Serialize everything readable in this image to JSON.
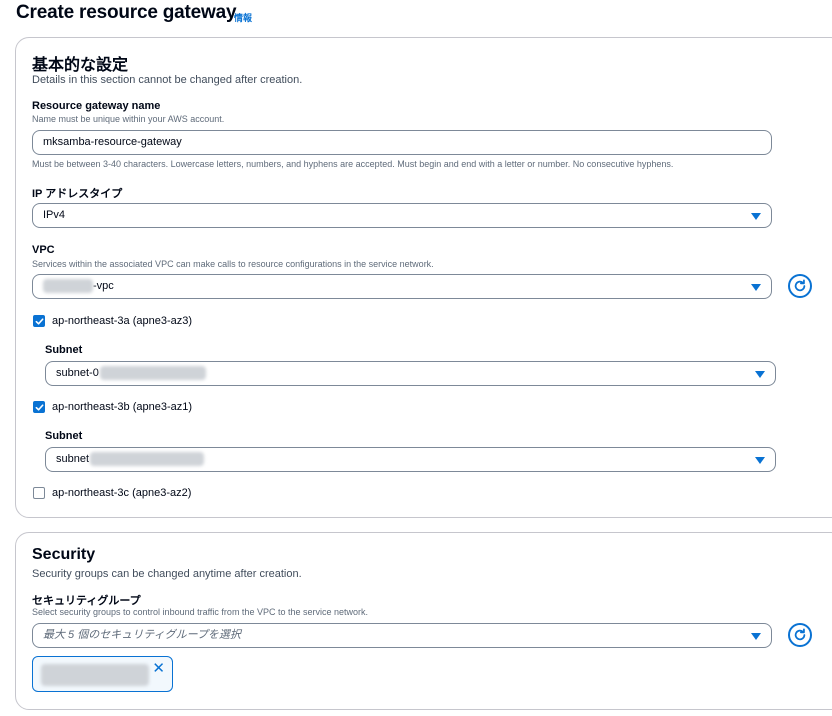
{
  "header": {
    "title": "Create resource gateway",
    "info": "情報"
  },
  "basic": {
    "title": "基本的な設定",
    "description": "Details in this section cannot be changed after creation.",
    "name": {
      "label": "Resource gateway name",
      "sublabel": "Name must be unique within your AWS account.",
      "value": "mksamba-resource-gateway",
      "hint": "Must be between 3-40 characters. Lowercase letters, numbers, and hyphens are accepted. Must begin and end with a letter or number. No consecutive hyphens."
    },
    "ip_type": {
      "label": "IP アドレスタイプ",
      "value": "IPv4"
    },
    "vpc": {
      "label": "VPC",
      "sublabel": "Services within the associated VPC can make calls to resource configurations in the service network.",
      "value_suffix": "-vpc"
    },
    "azs": [
      {
        "label": "ap-northeast-3a (apne3-az3)",
        "checked": true,
        "subnet_label": "Subnet",
        "subnet_prefix": "subnet-0"
      },
      {
        "label": "ap-northeast-3b (apne3-az1)",
        "checked": true,
        "subnet_label": "Subnet",
        "subnet_prefix": "subnet"
      },
      {
        "label": "ap-northeast-3c (apne3-az2)",
        "checked": false
      }
    ]
  },
  "security": {
    "title": "Security",
    "description": "Security groups can be changed anytime after creation.",
    "groups": {
      "label": "セキュリティグループ",
      "sublabel": "Select security groups to control inbound traffic from the VPC to the service network.",
      "placeholder": "最大 5 個のセキュリティグループを選択"
    }
  },
  "colors": {
    "accent": "#0972d3",
    "border": "#7d8998",
    "text": "#000716"
  },
  "icons": [
    "refresh-icon",
    "caret-down-icon",
    "check-icon",
    "close-icon"
  ]
}
